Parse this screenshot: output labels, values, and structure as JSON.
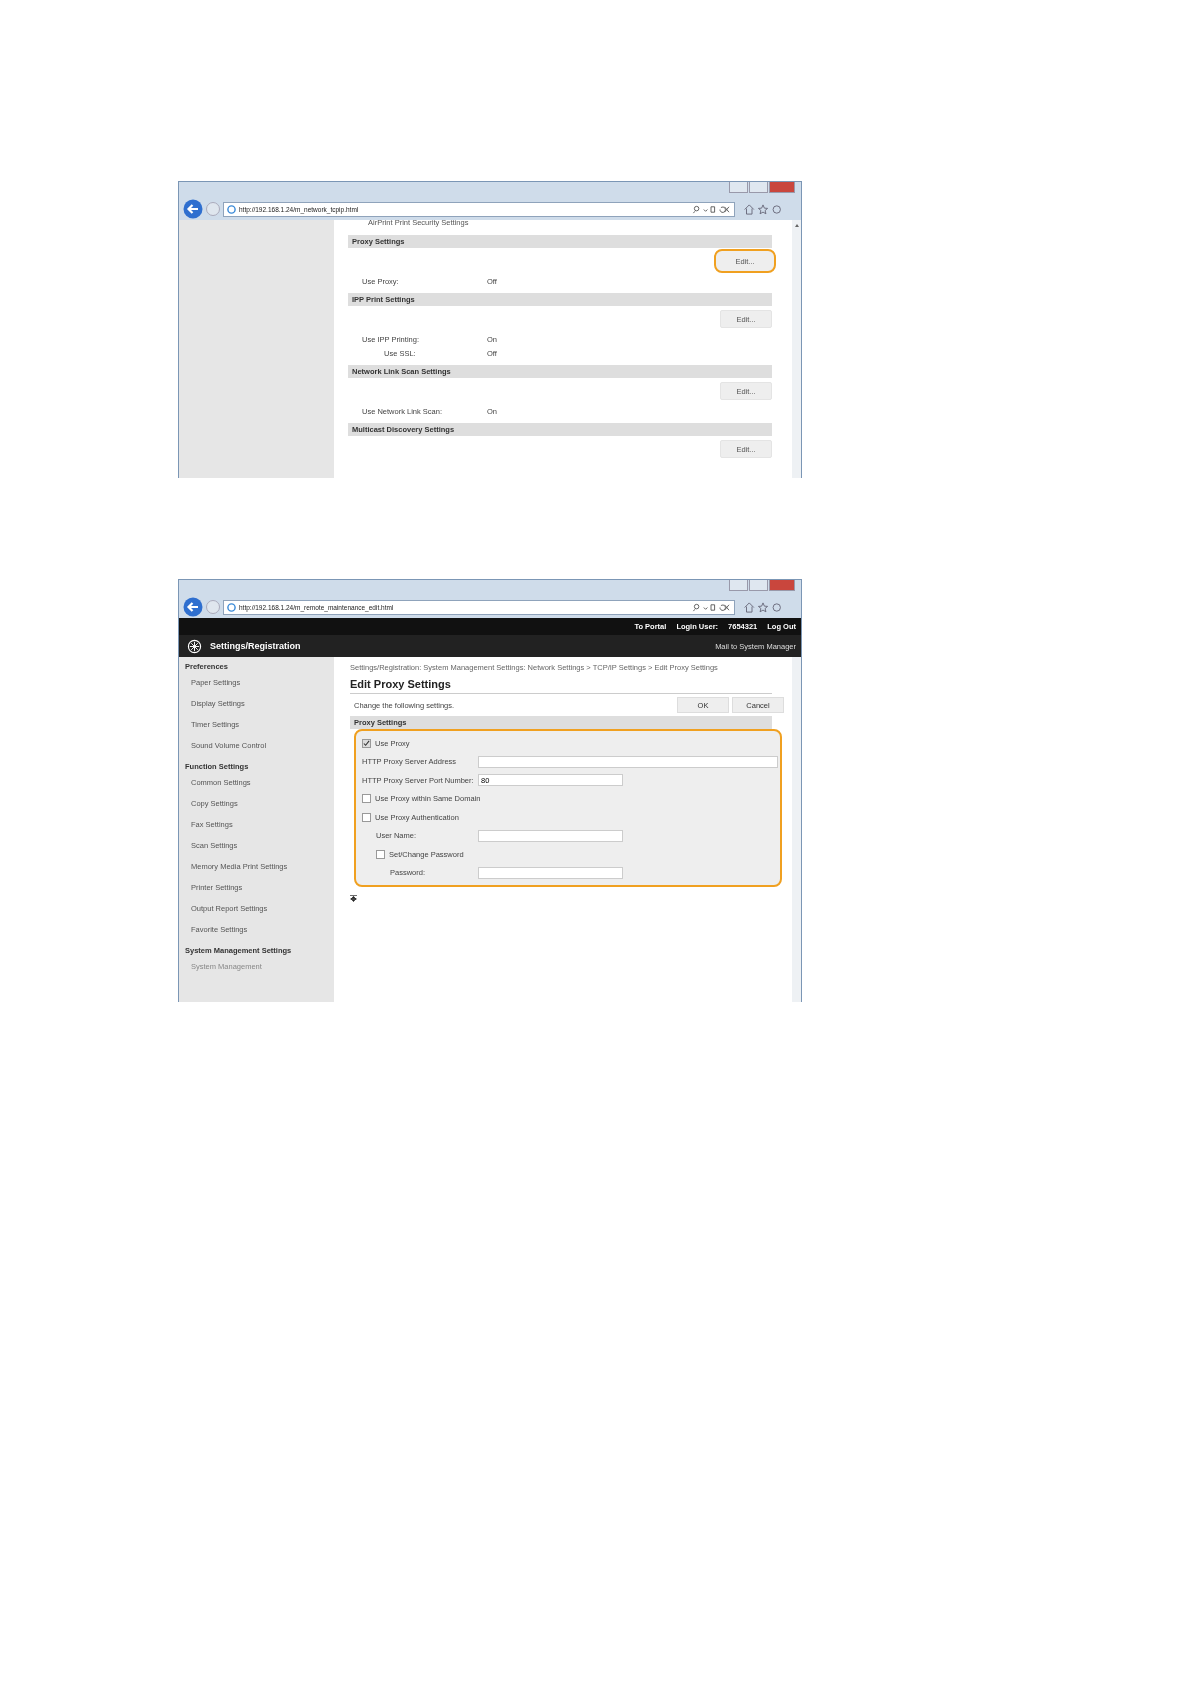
{
  "overview": {
    "url": "http://192.168.1.24/m_network_tcpip.html",
    "cut_heading": "AirPrint Print Security Settings",
    "sections": [
      {
        "title": "Proxy Settings",
        "button": "Edit...",
        "highlighted": true,
        "rows": [
          {
            "label": "Use Proxy:",
            "value": "Off"
          }
        ]
      },
      {
        "title": "IPP Print Settings",
        "button": "Edit...",
        "highlighted": false,
        "rows": [
          {
            "label": "Use IPP Printing:",
            "value": "On",
            "children": [
              {
                "label": "Use SSL:",
                "value": "Off"
              }
            ]
          }
        ]
      },
      {
        "title": "Network Link Scan Settings",
        "button": "Edit...",
        "highlighted": false,
        "rows": [
          {
            "label": "Use Network Link Scan:",
            "value": "On"
          }
        ]
      },
      {
        "title": "Multicast Discovery Settings",
        "button": "Edit...",
        "highlighted": false
      }
    ]
  },
  "edit": {
    "url": "http://192.168.1.24/m_remote_maintenance_edit.html",
    "to_portal": "To Portal",
    "login_label": "Login User:",
    "login_value": "7654321",
    "log_out": "Log Out",
    "app_title": "Settings/Registration",
    "mail_link": "Mail to System Manager",
    "sidebar": [
      {
        "title": "Preferences",
        "items": [
          "Paper Settings",
          "Display Settings",
          "Timer Settings",
          "Sound Volume Control"
        ]
      },
      {
        "title": "Function Settings",
        "items": [
          "Common Settings",
          "Copy Settings",
          "Fax Settings",
          "Scan Settings",
          "Memory Media Print Settings",
          "Printer Settings",
          "Output Report Settings",
          "Favorite Settings"
        ]
      },
      {
        "title": "System Management Settings",
        "items": [
          "System Management"
        ]
      }
    ],
    "breadcrumb": "Settings/Registration: System Management Settings: Network Settings > TCP/IP Settings > Edit Proxy Settings",
    "page_title": "Edit Proxy Settings",
    "instruction": "Change the following settings.",
    "buttons": [
      "OK",
      "Cancel"
    ],
    "form_title": "Proxy Settings",
    "highlighted": true,
    "fields": [
      {
        "kind": "checkbox",
        "label": "Use Proxy",
        "checked": true
      },
      {
        "kind": "wide-text",
        "label": "HTTP Proxy Server Address"
      },
      {
        "kind": "text",
        "label": "HTTP Proxy Server Port Number:",
        "value": "80"
      },
      {
        "kind": "checkbox",
        "label": "Use Proxy within Same Domain",
        "checked": false
      },
      {
        "kind": "checkbox",
        "label": "Use Proxy Authentication",
        "checked": false,
        "children": [
          {
            "kind": "text",
            "label": "User Name:"
          },
          {
            "kind": "checkbox",
            "label": "Set/Change Password",
            "checked": false,
            "children": [
              {
                "kind": "text",
                "label": "Password:"
              }
            ]
          }
        ]
      }
    ]
  }
}
